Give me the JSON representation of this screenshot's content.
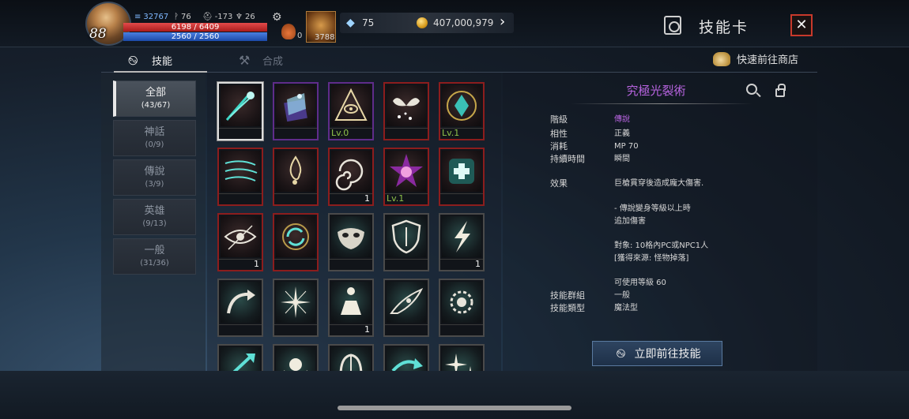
{
  "player": {
    "level": "88",
    "stat_power": "32767",
    "stat_attack": "76",
    "stat_defense": "-173",
    "stat_trophy": "26",
    "hp": "6198 / 6409",
    "mp": "2560 / 2560",
    "potion_count": "0",
    "feather_count": "3788"
  },
  "currency": {
    "diamond": "75",
    "gold": "407,000,979"
  },
  "header": {
    "title": "技能卡"
  },
  "tabs": [
    {
      "label": "技能"
    },
    {
      "label": "合成"
    }
  ],
  "shop_link": "快速前往商店",
  "categories": [
    {
      "name": "全部",
      "count": "(43/67)"
    },
    {
      "name": "神話",
      "count": "(0/9)"
    },
    {
      "name": "傳說",
      "count": "(3/9)"
    },
    {
      "name": "英雄",
      "count": "(9/13)"
    },
    {
      "name": "一般",
      "count": "(31/36)"
    }
  ],
  "grid": {
    "labels": {
      "r0c2": "Lv.0",
      "r0c4": "Lv.1",
      "r1c2": "1",
      "r1c3": "Lv.1",
      "r2c0": "1",
      "r2c4": "1",
      "r3c2": "1"
    },
    "icons": [
      "comet-icon",
      "spellbook-icon",
      "eye-pyramid-icon",
      "winged-heart-icon",
      "crystal-crest-icon",
      "wind-streams-icon",
      "flame-wisp-icon",
      "vortex-icon",
      "demon-star-icon",
      "healing-cross-icon",
      "watching-eye-icon",
      "cycle-arrows-icon",
      "mask-icon",
      "shield-icon",
      "lightning-icon",
      "curved-arrow-icon",
      "starburst-icon",
      "pyramid-figure-icon",
      "wing-eye-icon",
      "spiked-ring-icon",
      "arrow-strike-icon",
      "orb-icon",
      "helmet-icon",
      "dash-arrow-icon",
      "sparkle-icon"
    ]
  },
  "detail": {
    "skill_name": "究極光裂術",
    "rank_label": "階級",
    "rank_value": "傳說",
    "affinity_label": "相性",
    "affinity_value": "正義",
    "cost_label": "消耗",
    "cost_value": "MP 70",
    "duration_label": "持續時間",
    "duration_value": "瞬間",
    "effect_label": "效果",
    "effect_line1": "巨槍貫穿後造成龐大傷害.",
    "effect_line2": "- 傳說變身等級以上時",
    "effect_line3": "追加傷害",
    "effect_line4": "對象: 10格內PC或NPC1人",
    "effect_line5": "[獲得來源: 怪物掉落]",
    "effect_line6": "可使用等級 60",
    "group_label": "技能群組",
    "group_value": "一般",
    "type_label": "技能類型",
    "type_value": "魔法型",
    "go_button": "立即前往技能"
  },
  "colors": {
    "legend_purple": "#b864e0",
    "close_red": "#c8392b",
    "hp_red": "#c62e2e",
    "mp_blue": "#2e62c6",
    "level_green": "#8fc24a"
  }
}
